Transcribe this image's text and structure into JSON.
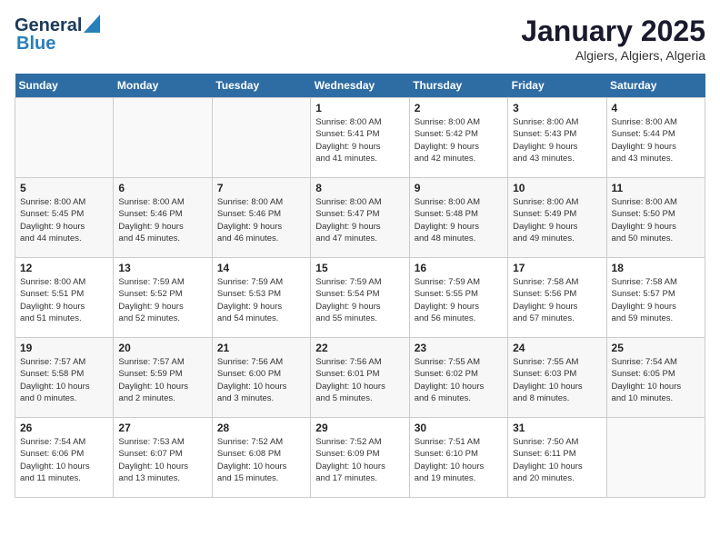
{
  "header": {
    "logo_general": "General",
    "logo_blue": "Blue",
    "title": "January 2025",
    "subtitle": "Algiers, Algiers, Algeria"
  },
  "days_of_week": [
    "Sunday",
    "Monday",
    "Tuesday",
    "Wednesday",
    "Thursday",
    "Friday",
    "Saturday"
  ],
  "weeks": [
    [
      {
        "day": "",
        "info": ""
      },
      {
        "day": "",
        "info": ""
      },
      {
        "day": "",
        "info": ""
      },
      {
        "day": "1",
        "info": "Sunrise: 8:00 AM\nSunset: 5:41 PM\nDaylight: 9 hours\nand 41 minutes."
      },
      {
        "day": "2",
        "info": "Sunrise: 8:00 AM\nSunset: 5:42 PM\nDaylight: 9 hours\nand 42 minutes."
      },
      {
        "day": "3",
        "info": "Sunrise: 8:00 AM\nSunset: 5:43 PM\nDaylight: 9 hours\nand 43 minutes."
      },
      {
        "day": "4",
        "info": "Sunrise: 8:00 AM\nSunset: 5:44 PM\nDaylight: 9 hours\nand 43 minutes."
      }
    ],
    [
      {
        "day": "5",
        "info": "Sunrise: 8:00 AM\nSunset: 5:45 PM\nDaylight: 9 hours\nand 44 minutes."
      },
      {
        "day": "6",
        "info": "Sunrise: 8:00 AM\nSunset: 5:46 PM\nDaylight: 9 hours\nand 45 minutes."
      },
      {
        "day": "7",
        "info": "Sunrise: 8:00 AM\nSunset: 5:46 PM\nDaylight: 9 hours\nand 46 minutes."
      },
      {
        "day": "8",
        "info": "Sunrise: 8:00 AM\nSunset: 5:47 PM\nDaylight: 9 hours\nand 47 minutes."
      },
      {
        "day": "9",
        "info": "Sunrise: 8:00 AM\nSunset: 5:48 PM\nDaylight: 9 hours\nand 48 minutes."
      },
      {
        "day": "10",
        "info": "Sunrise: 8:00 AM\nSunset: 5:49 PM\nDaylight: 9 hours\nand 49 minutes."
      },
      {
        "day": "11",
        "info": "Sunrise: 8:00 AM\nSunset: 5:50 PM\nDaylight: 9 hours\nand 50 minutes."
      }
    ],
    [
      {
        "day": "12",
        "info": "Sunrise: 8:00 AM\nSunset: 5:51 PM\nDaylight: 9 hours\nand 51 minutes."
      },
      {
        "day": "13",
        "info": "Sunrise: 7:59 AM\nSunset: 5:52 PM\nDaylight: 9 hours\nand 52 minutes."
      },
      {
        "day": "14",
        "info": "Sunrise: 7:59 AM\nSunset: 5:53 PM\nDaylight: 9 hours\nand 54 minutes."
      },
      {
        "day": "15",
        "info": "Sunrise: 7:59 AM\nSunset: 5:54 PM\nDaylight: 9 hours\nand 55 minutes."
      },
      {
        "day": "16",
        "info": "Sunrise: 7:59 AM\nSunset: 5:55 PM\nDaylight: 9 hours\nand 56 minutes."
      },
      {
        "day": "17",
        "info": "Sunrise: 7:58 AM\nSunset: 5:56 PM\nDaylight: 9 hours\nand 57 minutes."
      },
      {
        "day": "18",
        "info": "Sunrise: 7:58 AM\nSunset: 5:57 PM\nDaylight: 9 hours\nand 59 minutes."
      }
    ],
    [
      {
        "day": "19",
        "info": "Sunrise: 7:57 AM\nSunset: 5:58 PM\nDaylight: 10 hours\nand 0 minutes."
      },
      {
        "day": "20",
        "info": "Sunrise: 7:57 AM\nSunset: 5:59 PM\nDaylight: 10 hours\nand 2 minutes."
      },
      {
        "day": "21",
        "info": "Sunrise: 7:56 AM\nSunset: 6:00 PM\nDaylight: 10 hours\nand 3 minutes."
      },
      {
        "day": "22",
        "info": "Sunrise: 7:56 AM\nSunset: 6:01 PM\nDaylight: 10 hours\nand 5 minutes."
      },
      {
        "day": "23",
        "info": "Sunrise: 7:55 AM\nSunset: 6:02 PM\nDaylight: 10 hours\nand 6 minutes."
      },
      {
        "day": "24",
        "info": "Sunrise: 7:55 AM\nSunset: 6:03 PM\nDaylight: 10 hours\nand 8 minutes."
      },
      {
        "day": "25",
        "info": "Sunrise: 7:54 AM\nSunset: 6:05 PM\nDaylight: 10 hours\nand 10 minutes."
      }
    ],
    [
      {
        "day": "26",
        "info": "Sunrise: 7:54 AM\nSunset: 6:06 PM\nDaylight: 10 hours\nand 11 minutes."
      },
      {
        "day": "27",
        "info": "Sunrise: 7:53 AM\nSunset: 6:07 PM\nDaylight: 10 hours\nand 13 minutes."
      },
      {
        "day": "28",
        "info": "Sunrise: 7:52 AM\nSunset: 6:08 PM\nDaylight: 10 hours\nand 15 minutes."
      },
      {
        "day": "29",
        "info": "Sunrise: 7:52 AM\nSunset: 6:09 PM\nDaylight: 10 hours\nand 17 minutes."
      },
      {
        "day": "30",
        "info": "Sunrise: 7:51 AM\nSunset: 6:10 PM\nDaylight: 10 hours\nand 19 minutes."
      },
      {
        "day": "31",
        "info": "Sunrise: 7:50 AM\nSunset: 6:11 PM\nDaylight: 10 hours\nand 20 minutes."
      },
      {
        "day": "",
        "info": ""
      }
    ]
  ]
}
